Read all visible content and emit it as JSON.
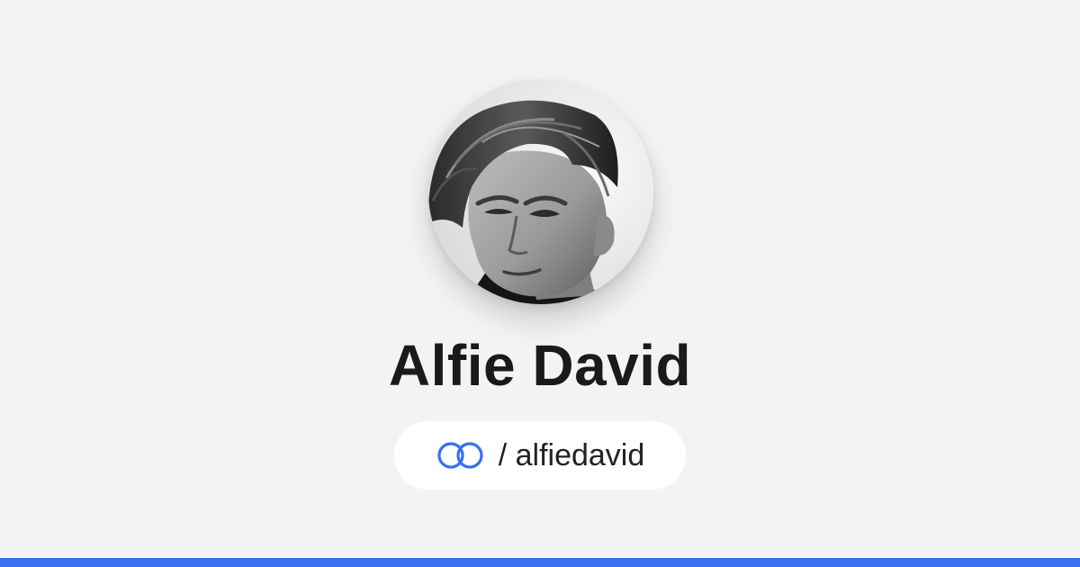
{
  "profile": {
    "display_name": "Alfie David",
    "handle_text": "/ alfiedavid",
    "avatar_alt": "Profile photo"
  },
  "icons": {
    "handle": "link-rings-icon"
  },
  "colors": {
    "background": "#f3f3f5",
    "accent": "#3a6ff0",
    "pill": "#ffffff",
    "name_text": "#1a1a1a"
  }
}
